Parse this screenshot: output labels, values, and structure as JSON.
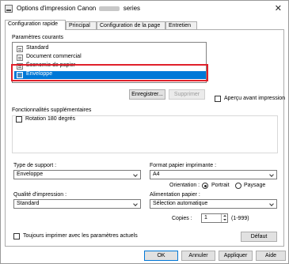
{
  "window": {
    "title_prefix": "Options d'impression Canon",
    "title_suffix": "series"
  },
  "tabs": [
    {
      "label": "Configuration rapide",
      "active": true
    },
    {
      "label": "Principal",
      "active": false
    },
    {
      "label": "Configuration de la page",
      "active": false
    },
    {
      "label": "Entretien",
      "active": false
    }
  ],
  "current_settings": {
    "label": "Paramètres courants",
    "items": [
      {
        "label": "Standard"
      },
      {
        "label": "Document commercial"
      },
      {
        "label": "Économie de papier"
      },
      {
        "label": "Enveloppe",
        "selected": true
      }
    ],
    "save_button": "Enregistrer...",
    "delete_button": "Supprimer",
    "preview_checkbox": "Aperçu avant impression"
  },
  "additional_features": {
    "label": "Fonctionnalités supplémentaires",
    "rotate_180": "Rotation 180 degrés"
  },
  "media_type": {
    "label": "Type de support :",
    "value": "Enveloppe"
  },
  "paper_size": {
    "label": "Format papier imprimante :",
    "value": "A4"
  },
  "orientation": {
    "label": "Orientation :",
    "portrait": "Portrait",
    "landscape": "Paysage",
    "selected": "portrait"
  },
  "print_quality": {
    "label": "Qualité d'impression :",
    "value": "Standard"
  },
  "paper_source": {
    "label": "Alimentation papier :",
    "value": "Sélection automatique"
  },
  "copies": {
    "label": "Copies :",
    "value": "1",
    "range": "(1-999)"
  },
  "always_print": "Toujours imprimer avec les paramètres actuels",
  "default_button": "Défaut",
  "footer": {
    "ok": "OK",
    "cancel": "Annuler",
    "apply": "Appliquer",
    "help": "Aide"
  }
}
